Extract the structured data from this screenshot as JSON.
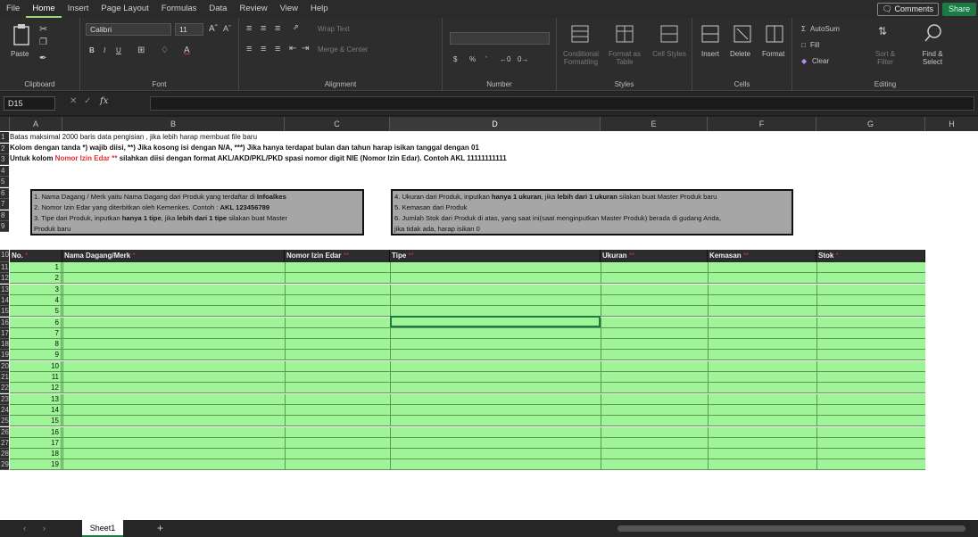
{
  "menu": {
    "tabs": [
      "File",
      "Home",
      "Insert",
      "Page Layout",
      "Formulas",
      "Data",
      "Review",
      "View",
      "Help"
    ],
    "comments": "Comments",
    "share": "Share"
  },
  "ribbon": {
    "clipboard": {
      "label": "Clipboard",
      "paste": "Paste"
    },
    "font": {
      "label": "Font",
      "name": "Calibri",
      "size": "11"
    },
    "alignment": {
      "label": "Alignment",
      "wrap": "Wrap Text",
      "merge": "Merge & Center"
    },
    "number": {
      "label": "Number",
      "format": ""
    },
    "styles": {
      "label": "Styles",
      "conditional": "Conditional Formatting",
      "format_table": "Format as Table",
      "cell_styles": "Cell Styles"
    },
    "cells": {
      "label": "Cells",
      "insert": "Insert",
      "delete": "Delete",
      "format": "Format"
    },
    "editing": {
      "label": "Editing",
      "autosum": "AutoSum",
      "fill": "Fill",
      "clear": "Clear",
      "sort": "Sort & Filter",
      "find": "Find & Select"
    }
  },
  "formula_bar": {
    "name_box": "D15",
    "fx": "fx",
    "content": ""
  },
  "columns": [
    "A",
    "B",
    "C",
    "D",
    "E",
    "F",
    "G",
    "H"
  ],
  "notices": {
    "row1": "Batas maksimal 2000 baris data pengisian , jika lebih harap membuat file baru",
    "row2a": "Kolom dengan tanda *) wajib diisi, **) Jika kosong isi dengan N/A, ***) ",
    "row2b": "Jika hanya terdapat bulan dan tahun harap isikan tanggal dengan 01",
    "row3a": "Untuk kolom ",
    "row3b": "Nomor Izin Edar **",
    "row3c": " silahkan diisi dengan format AKL/AKD/PKL/PKD spasi nomor digit NIE (Nomor Izin Edar). Contoh AKL 11111111111"
  },
  "info_left": {
    "l1a": "1. Nama Dagang / Merk yaitu Nama Dagang dari Produk yang terdaftar di ",
    "l1b": "Infoalkes",
    "l2a": "2. Nomor Izin Edar yang diterbitkan oleh Kemenkes. Contoh : ",
    "l2b": "AKL 123456789",
    "l3a": "3. Tipe dari Produk, inputkan ",
    "l3b": "hanya 1 tipe",
    ", ": "",
    "l3c": ", jika ",
    "l3d": "lebih dari 1 tipe",
    "l3e": " silakan buat Master",
    "l4": "Produk baru"
  },
  "info_right": {
    "l1a": "4. Ukuran dari Produk, inputkan ",
    "l1b": "hanya 1 ukuran",
    "l1c": ", jika ",
    "l1d": "lebih dari 1 ukuran",
    "l1e": " silakan buat Master Produk baru",
    "l2": "5. Kemasan dari Produk",
    "l3": "6. Jumlah Stok dari Produk di atas, yang saat ini(saat menginputkan Master Produk) berada di gudang Anda,",
    "l4": "jika tidak ada, harap isikan 0"
  },
  "table": {
    "headers": [
      {
        "label": "No.",
        "mark": "*"
      },
      {
        "label": "Nama Dagang/Merk",
        "mark": "*"
      },
      {
        "label": "Nomor Izin Edar",
        "mark": "**"
      },
      {
        "label": "Tipe",
        "mark": "**"
      },
      {
        "label": "Ukuran",
        "mark": "**"
      },
      {
        "label": "Kemasan",
        "mark": "**"
      },
      {
        "label": "Stok",
        "mark": "*"
      }
    ],
    "rows": [
      "1",
      "2",
      "3",
      "4",
      "5",
      "6",
      "7",
      "8",
      "9",
      "10",
      "11",
      "12",
      "13",
      "14",
      "15",
      "16",
      "17",
      "18",
      "19"
    ]
  },
  "row_numbers": [
    "1",
    "2",
    "3",
    "4",
    "5",
    "6",
    "7",
    "8",
    "9",
    "10",
    "11",
    "12",
    "13",
    "14",
    "15",
    "16",
    "17",
    "18",
    "19",
    "20",
    "21",
    "22",
    "23",
    "24",
    "25",
    "26",
    "27",
    "28",
    "29"
  ],
  "sheet": {
    "tab": "Sheet1",
    "add": "+"
  }
}
